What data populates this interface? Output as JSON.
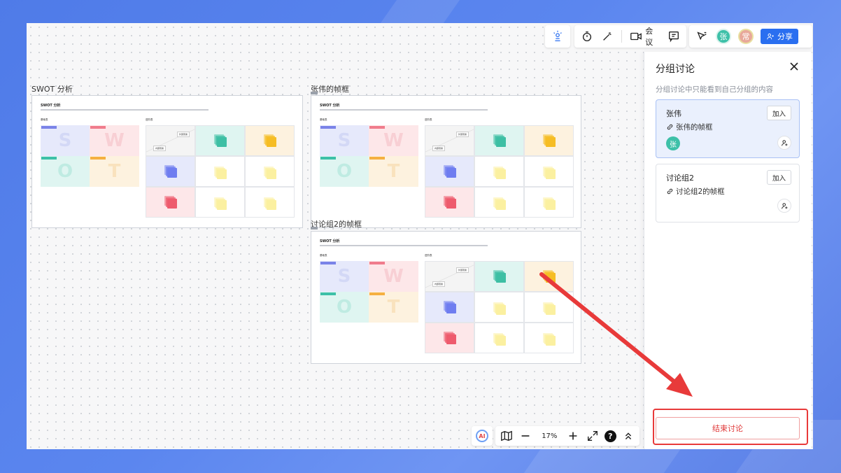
{
  "toolbar": {
    "meeting_label": "会议",
    "avatar1": "张",
    "avatar2": "常",
    "share_label": "分享",
    "colors": {
      "avatar1": "#3dc0a8",
      "avatar2": "#e8a89a",
      "share": "#2a6ff0"
    }
  },
  "frames": {
    "swot_title": "SWOT 分析",
    "zhangwei_title": "张伟的帧框",
    "group2_title": "讨论组2的帧框",
    "doc_heading": "SWOT 分析",
    "section_left": "基础表",
    "section_right": "进阶表",
    "letters": [
      "S",
      "W",
      "O",
      "T"
    ],
    "inner_label": "内部因素",
    "outer_label": "外部因素"
  },
  "panel": {
    "title": "分组讨论",
    "subtitle": "分组讨论中只能看到自己分组的内容",
    "groups": [
      {
        "name": "张伟",
        "link": "张伟的帧框",
        "join": "加入",
        "member": "张"
      },
      {
        "name": "讨论组2",
        "link": "讨论组2的帧框",
        "join": "加入"
      }
    ],
    "end_button": "结束讨论"
  },
  "bottom": {
    "ai_label": "AI",
    "zoom": "17%",
    "help": "?"
  },
  "colors": {
    "highlight": "#e83a3a",
    "s": "#e6e9fb",
    "w": "#fde7e9",
    "o": "#dff5f1",
    "t": "#fdf2df"
  }
}
